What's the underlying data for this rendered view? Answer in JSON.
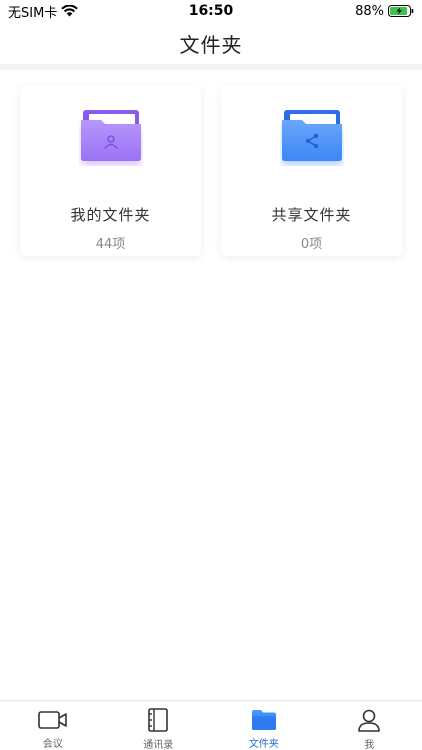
{
  "status_bar": {
    "carrier": "无SIM卡",
    "time": "16:50",
    "battery": "88%"
  },
  "header": {
    "title": "文件夹"
  },
  "folders": [
    {
      "name": "我的文件夹",
      "count": "44项",
      "icon": "personal-folder-icon",
      "color": "#9b6cf6"
    },
    {
      "name": "共享文件夹",
      "count": "0项",
      "icon": "shared-folder-icon",
      "color": "#3d86f5"
    }
  ],
  "tabs": [
    {
      "label": "会议",
      "icon": "video-camera-icon",
      "active": false
    },
    {
      "label": "通讯录",
      "icon": "contacts-book-icon",
      "active": false
    },
    {
      "label": "文件夹",
      "icon": "folder-icon",
      "active": true
    },
    {
      "label": "我",
      "icon": "person-icon",
      "active": false
    }
  ],
  "colors": {
    "accent": "#2a6ad8",
    "personal_folder": "#9b6cf6",
    "shared_folder": "#3d86f5"
  }
}
